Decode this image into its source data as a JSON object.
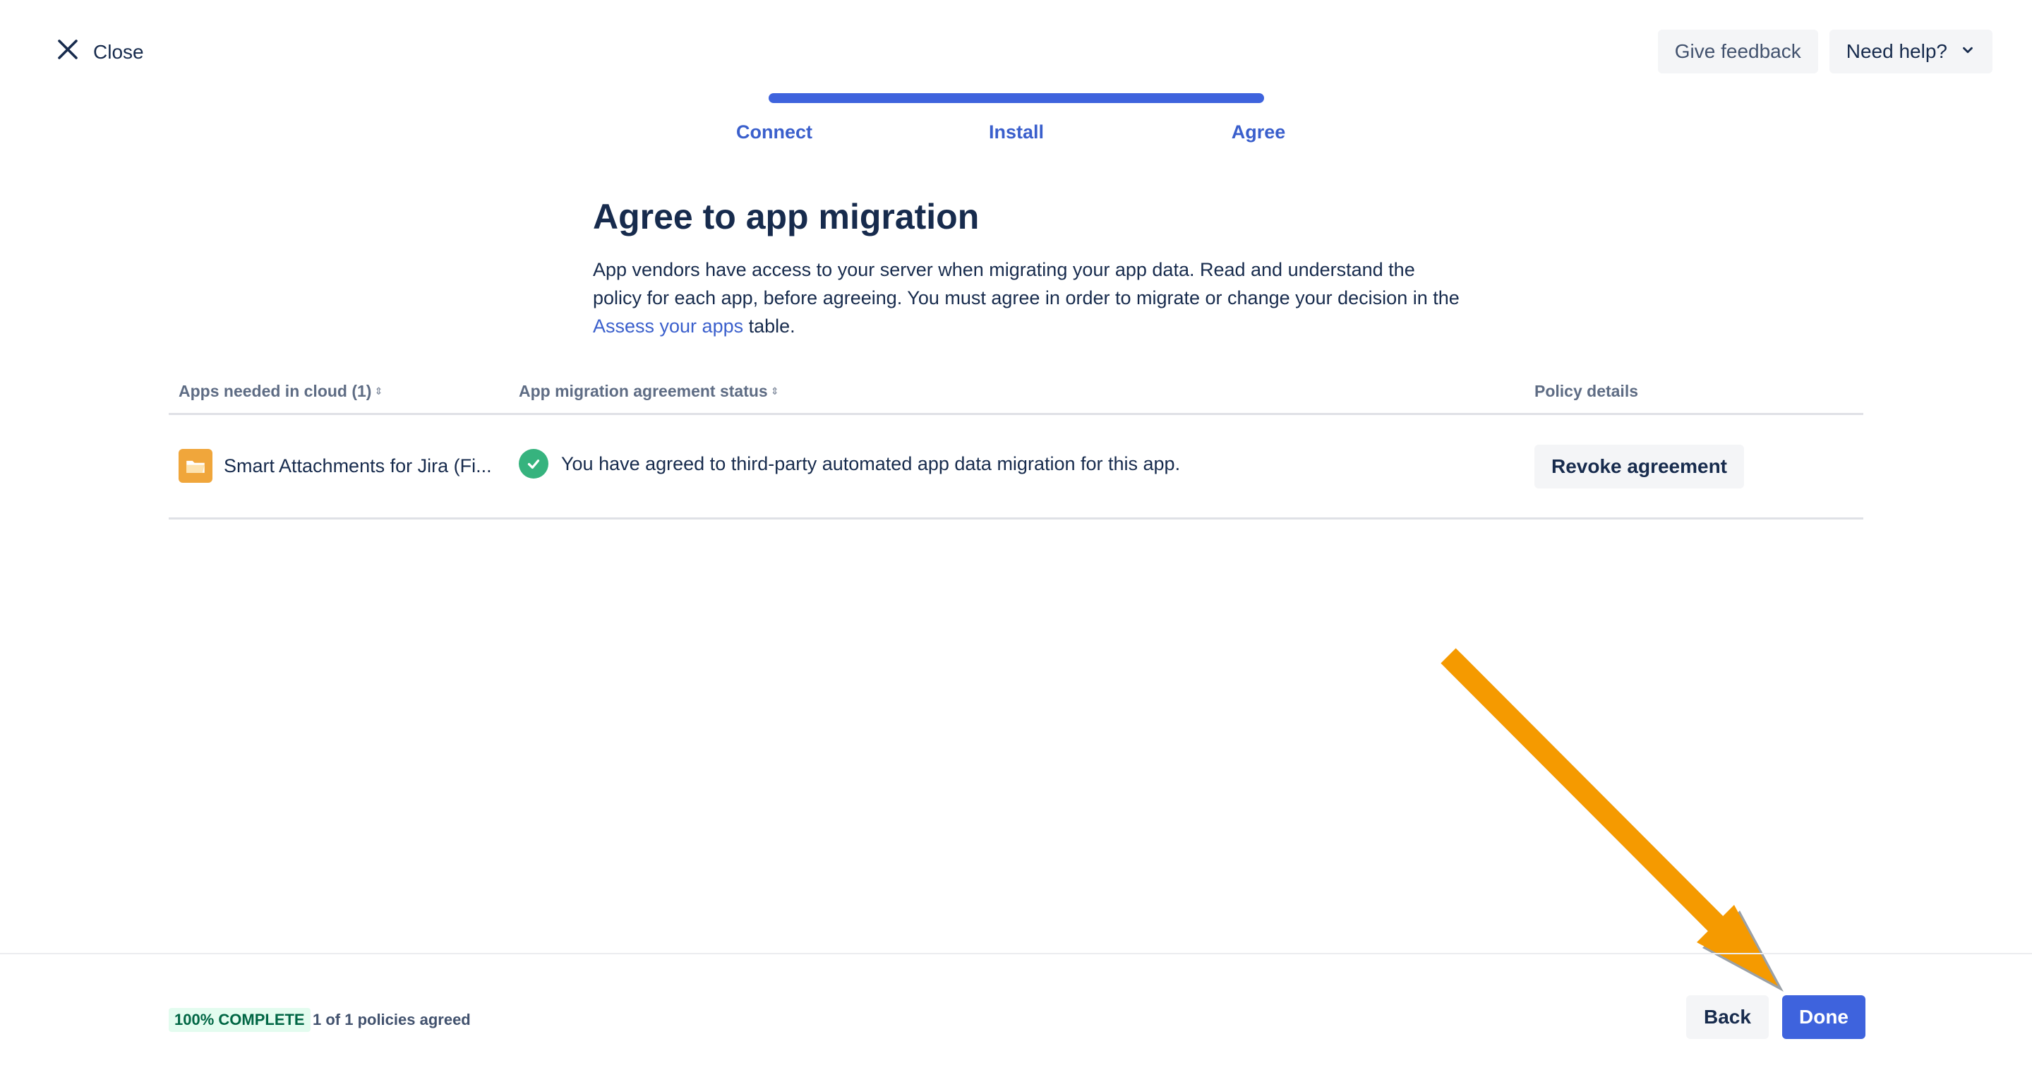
{
  "header": {
    "close_label": "Close",
    "feedback_label": "Give feedback",
    "help_label": "Need help?"
  },
  "steps": [
    {
      "label": "Connect"
    },
    {
      "label": "Install"
    },
    {
      "label": "Agree"
    }
  ],
  "progress_fraction": 1.0,
  "main": {
    "title": "Agree to app migration",
    "description_before": "App vendors have access to your server when migrating your app data. Read and understand the policy for each app, before agreeing. You must agree in order to migrate or change your decision in the ",
    "description_link": "Assess your apps",
    "description_after": " table."
  },
  "table": {
    "columns": [
      {
        "label": "Apps needed in cloud (1)",
        "sortable": true
      },
      {
        "label": "App migration agreement status",
        "sortable": true
      },
      {
        "label": "Policy details",
        "sortable": false
      }
    ],
    "rows": [
      {
        "app_name": "Smart Attachments for Jira (Fi...",
        "status": "You have agreed to third-party automated app data migration for this app.",
        "action_label": "Revoke agreement"
      }
    ]
  },
  "footer": {
    "complete_badge": "100% COMPLETE",
    "policies_text": "1 of 1 policies agreed",
    "back_label": "Back",
    "done_label": "Done"
  },
  "colors": {
    "primary": "#3e63dd",
    "success": "#36b37e",
    "annotation_arrow": "#f59a00"
  },
  "icons": {
    "close": "close-icon",
    "chevron": "chevron-down-icon",
    "app_logo": "folder-icon",
    "status": "check-circle-icon",
    "sort": "sort-icon"
  }
}
